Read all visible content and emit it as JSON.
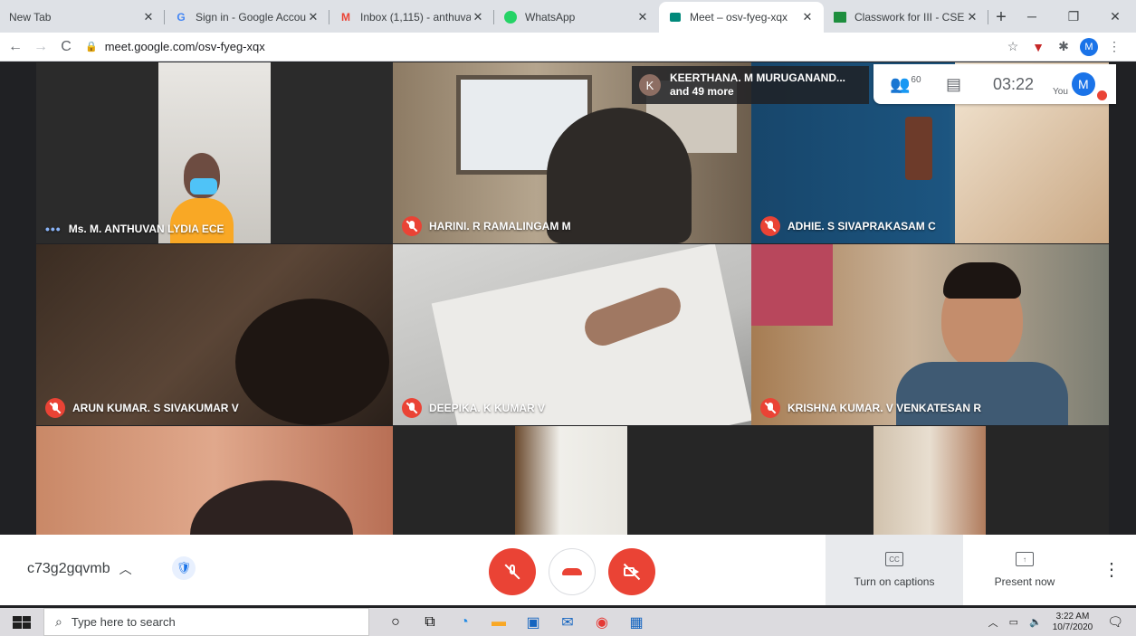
{
  "browser": {
    "tabs": [
      {
        "title": "New Tab",
        "favicon": "none",
        "active": false
      },
      {
        "title": "Sign in - Google Accou",
        "favicon": "google-g",
        "active": false
      },
      {
        "title": "Inbox (1,115) - anthuva",
        "favicon": "gmail-m",
        "active": false
      },
      {
        "title": "WhatsApp",
        "favicon": "whatsapp",
        "active": false
      },
      {
        "title": "Meet – osv-fyeg-xqx",
        "favicon": "meet",
        "active": true
      },
      {
        "title": "Classwork for III - CSE A",
        "favicon": "classroom",
        "active": false
      }
    ],
    "new_tab": "+",
    "address": "meet.google.com/osv-fyeg-xqx",
    "profile_initial": "M"
  },
  "meet": {
    "participants_overlay": {
      "avatar_initial": "K",
      "line1": "KEERTHANA. M MURUGANAND...",
      "line2": "and 49 more"
    },
    "people_count": "60",
    "time": "03:22",
    "you_label": "You",
    "self_initial": "M",
    "tiles": [
      {
        "name": "Ms. M. ANTHUVAN LYDIA ECE",
        "status": "speaking"
      },
      {
        "name": "HARINI. R RAMALINGAM M",
        "status": "muted"
      },
      {
        "name": "ADHIE. S SIVAPRAKASAM C",
        "status": "muted"
      },
      {
        "name": "ARUN KUMAR. S SIVAKUMAR V",
        "status": "muted"
      },
      {
        "name": "DEEPIKA. K KUMAR V",
        "status": "muted"
      },
      {
        "name": "KRISHNA KUMAR. V VENKATESAN R",
        "status": "muted"
      }
    ]
  },
  "controls": {
    "meeting_code": "c73g2gqvmb",
    "captions_label": "Turn on captions",
    "captions_icon": "CC",
    "present_label": "Present now"
  },
  "taskbar": {
    "search_placeholder": "Type here to search",
    "time": "3:22 AM",
    "date": "10/7/2020"
  },
  "colors": {
    "danger": "#ea4335",
    "accent": "#1a73e8",
    "meet_bg": "#202124"
  }
}
